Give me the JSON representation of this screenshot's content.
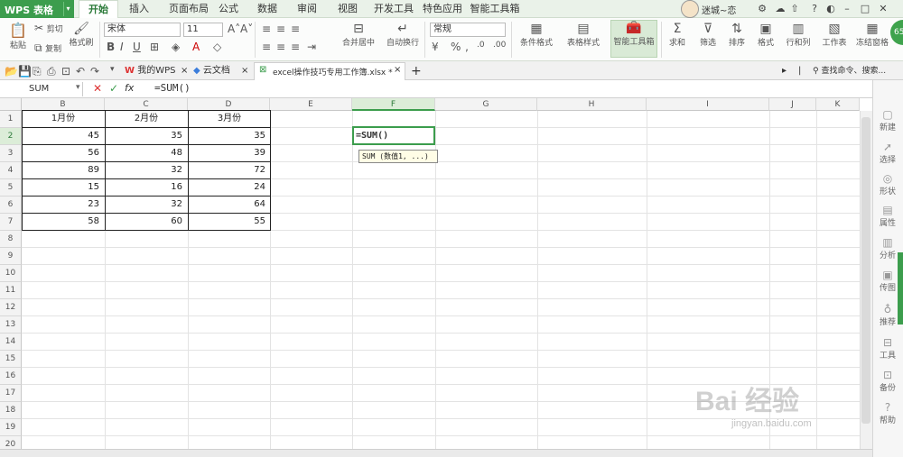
{
  "app": {
    "name": "WPS 表格",
    "user": "迷城~恋"
  },
  "menu_tabs": [
    "开始",
    "插入",
    "页面布局",
    "公式",
    "数据",
    "审阅",
    "视图",
    "开发工具",
    "特色应用",
    "智能工具箱"
  ],
  "ribbon": {
    "paste": "粘贴",
    "cut": "剪切",
    "copy": "复制",
    "format_painter": "格式刷",
    "font_name": "宋体",
    "font_size": "11",
    "merge": "合并居中",
    "wrap": "自动换行",
    "number_format": "常规",
    "cond_format": "条件格式",
    "table_style": "表格样式",
    "smart_toolbox": "智能工具箱",
    "sum": "求和",
    "filter": "筛选",
    "sort": "排序",
    "format": "格式",
    "row_col": "行和列",
    "worksheet": "工作表",
    "freeze": "冻结窗格",
    "progress": "65"
  },
  "doc_tabs": {
    "my_wps": "我的WPS",
    "cloud": "云文档",
    "active": "excel操作技巧专用工作簿.xlsx *"
  },
  "search_label": "查找命令、搜索...",
  "formula_bar": {
    "name_box": "SUM",
    "fx": "fx",
    "content": "=SUM()"
  },
  "columns": [
    "B",
    "C",
    "D",
    "E",
    "F",
    "G",
    "H",
    "I",
    "J",
    "K"
  ],
  "rows": [
    "1",
    "2",
    "3",
    "4",
    "5",
    "6",
    "7",
    "8",
    "9",
    "10",
    "11",
    "12",
    "13",
    "14",
    "15",
    "16",
    "17",
    "18",
    "19",
    "20"
  ],
  "table": {
    "headers": [
      "1月份",
      "2月份",
      "3月份"
    ],
    "data": [
      [
        "45",
        "35",
        "35"
      ],
      [
        "56",
        "48",
        "39"
      ],
      [
        "89",
        "32",
        "72"
      ],
      [
        "15",
        "16",
        "24"
      ],
      [
        "23",
        "32",
        "64"
      ],
      [
        "58",
        "60",
        "55"
      ]
    ]
  },
  "active_cell": {
    "content": "=SUM()",
    "tooltip": "SUM (数值1, ...)"
  },
  "sidebar": [
    "新建",
    "选择",
    "形状",
    "属性",
    "分析",
    "传图",
    "推荐",
    "工具",
    "备份",
    "帮助"
  ],
  "watermark": {
    "main": "Bai 经验",
    "sub": "jingyan.baidu.com"
  }
}
